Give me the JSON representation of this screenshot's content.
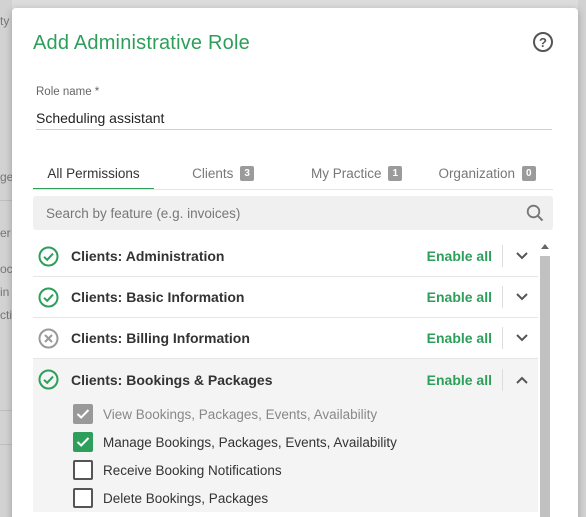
{
  "dialog": {
    "title": "Add Administrative Role",
    "help_icon": "help-circle-icon"
  },
  "role_name": {
    "label": "Role name *",
    "value": "Scheduling assistant"
  },
  "tabs": [
    {
      "label": "All Permissions",
      "active": true
    },
    {
      "label": "Clients",
      "count": "3"
    },
    {
      "label": "My Practice",
      "count": "1"
    },
    {
      "label": "Organization",
      "count": "0"
    }
  ],
  "search": {
    "placeholder": "Search by feature (e.g. invoices)",
    "icon": "search-icon"
  },
  "permissions": [
    {
      "name": "Clients: Administration",
      "status": "enabled",
      "enable_label": "Enable all",
      "chevron": "down"
    },
    {
      "name": "Clients: Basic Information",
      "status": "enabled",
      "enable_label": "Enable all",
      "chevron": "down"
    },
    {
      "name": "Clients: Billing Information",
      "status": "disabled",
      "enable_label": "Enable all",
      "chevron": "down"
    },
    {
      "name": "Clients: Bookings & Packages",
      "status": "enabled",
      "enable_label": "Enable all",
      "chevron": "up",
      "items": [
        {
          "label": "View Bookings, Packages, Events, Availability",
          "checked": true,
          "disabled": true
        },
        {
          "label": "Manage Bookings, Packages, Events, Availability",
          "checked": true,
          "disabled": false
        },
        {
          "label": "Receive Booking Notifications",
          "checked": false,
          "disabled": false
        },
        {
          "label": "Delete Bookings, Packages",
          "checked": false,
          "disabled": false
        }
      ]
    }
  ],
  "backdrop_fragments": [
    "ty",
    "ge",
    "er",
    "oc",
    "in",
    "cti"
  ],
  "colors": {
    "accent": "#2e9e5b",
    "badge": "#9b9b9b",
    "disabled_icon": "#999999"
  }
}
